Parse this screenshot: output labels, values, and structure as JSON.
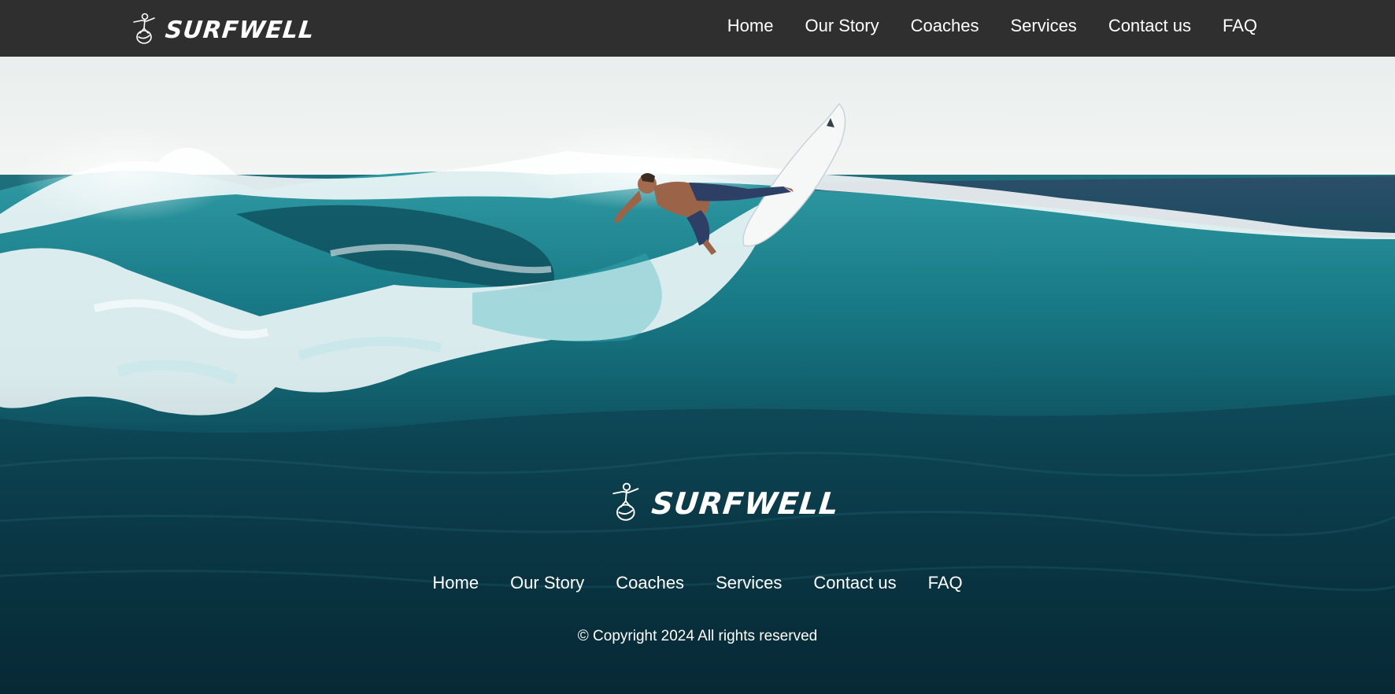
{
  "brand": {
    "name": "SURFWELL",
    "logo_icon": "surfer-icon"
  },
  "topnav": {
    "items": [
      {
        "label": "Home"
      },
      {
        "label": "Our Story"
      },
      {
        "label": "Coaches"
      },
      {
        "label": "Services"
      },
      {
        "label": "Contact us"
      },
      {
        "label": "FAQ"
      }
    ]
  },
  "footer": {
    "brand_name": "SURFWELL",
    "items": [
      {
        "label": "Home"
      },
      {
        "label": "Our Story"
      },
      {
        "label": "Coaches"
      },
      {
        "label": "Services"
      },
      {
        "label": "Contact us"
      },
      {
        "label": "FAQ"
      }
    ],
    "copyright": "© Copyright 2024 All rights reserved"
  },
  "colors": {
    "topbar": "#2f2f2f",
    "text": "#ffffff",
    "ocean": "#0d3d4c"
  }
}
